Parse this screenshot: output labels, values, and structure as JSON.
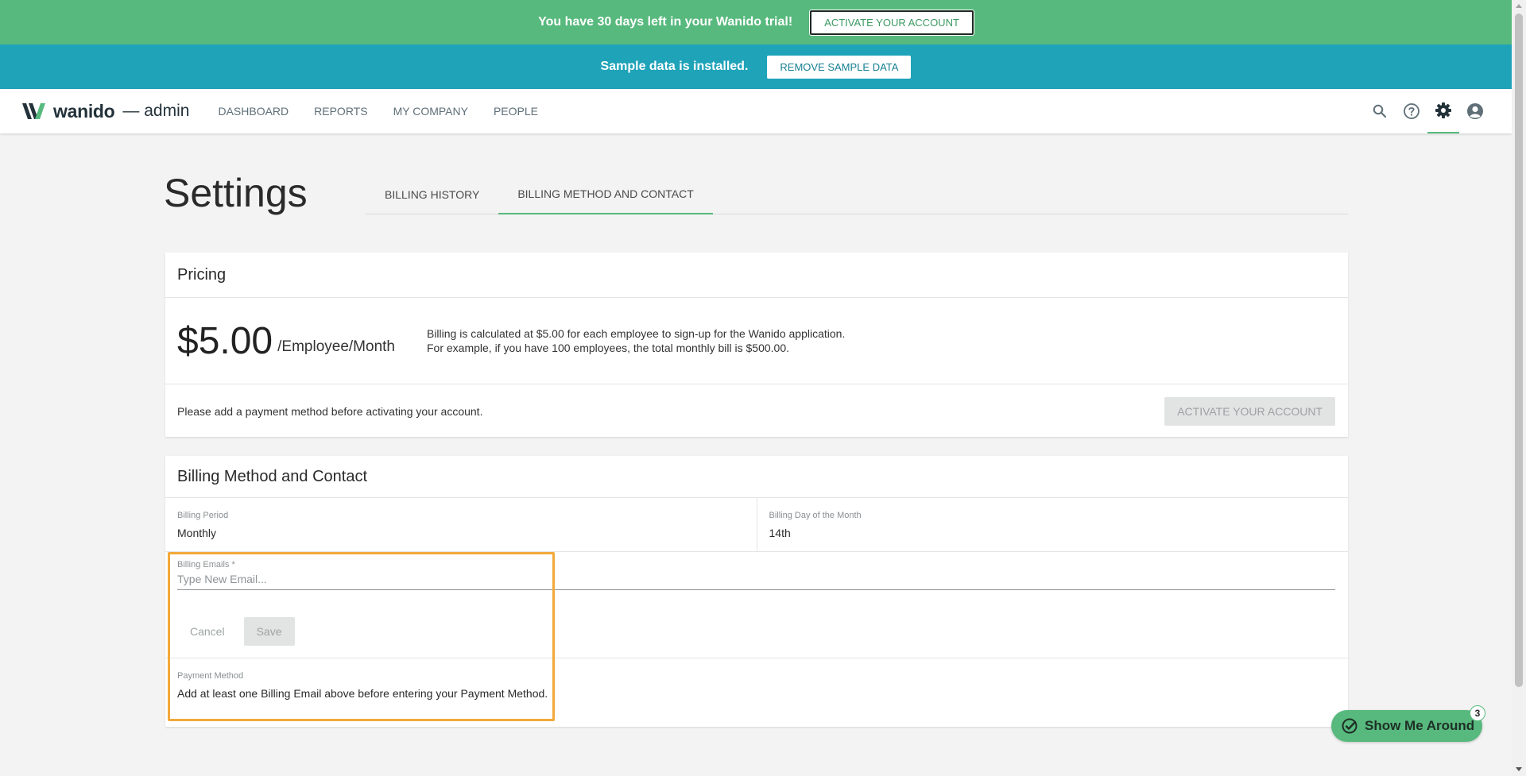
{
  "banner_trial": {
    "text": "You have 30 days left in your Wanido trial!",
    "button": "ACTIVATE YOUR ACCOUNT"
  },
  "banner_sample": {
    "text": "Sample data is installed.",
    "button": "REMOVE SAMPLE DATA"
  },
  "nav": {
    "brand": "wanido",
    "brand_suffix": "— admin",
    "links": [
      "DASHBOARD",
      "REPORTS",
      "MY COMPANY",
      "PEOPLE"
    ],
    "icons": [
      "search-icon",
      "help-icon",
      "settings-icon",
      "account-icon"
    ]
  },
  "page": {
    "title": "Settings",
    "tabs": [
      "BILLING HISTORY",
      "BILLING METHOD AND CONTACT"
    ],
    "active_tab": "BILLING METHOD AND CONTACT"
  },
  "pricing": {
    "title": "Pricing",
    "amount": "$5.00",
    "unit": "/Employee/Month",
    "desc_line1": "Billing is calculated at $5.00 for each employee to sign-up for the Wanido application.",
    "desc_line2": "For example, if you have 100 employees, the total monthly bill is $500.00.",
    "notice": "Please add a payment method before activating your account.",
    "activate_button": "ACTIVATE YOUR ACCOUNT"
  },
  "billing": {
    "title": "Billing Method and Contact",
    "period_label": "Billing Period",
    "period_value": "Monthly",
    "day_label": "Billing Day of the Month",
    "day_value": "14th",
    "emails_label": "Billing Emails *",
    "emails_placeholder": "Type New Email...",
    "emails_value": "",
    "cancel": "Cancel",
    "save": "Save",
    "payment_label": "Payment Method",
    "payment_text": "Add at least one Billing Email above before entering your Payment Method."
  },
  "tour": {
    "label": "Show Me Around",
    "badge": "3"
  },
  "colors": {
    "green": "#57b97d",
    "teal": "#1fa3b9",
    "highlight": "#f2a93b",
    "background": "#f2f3f2"
  }
}
